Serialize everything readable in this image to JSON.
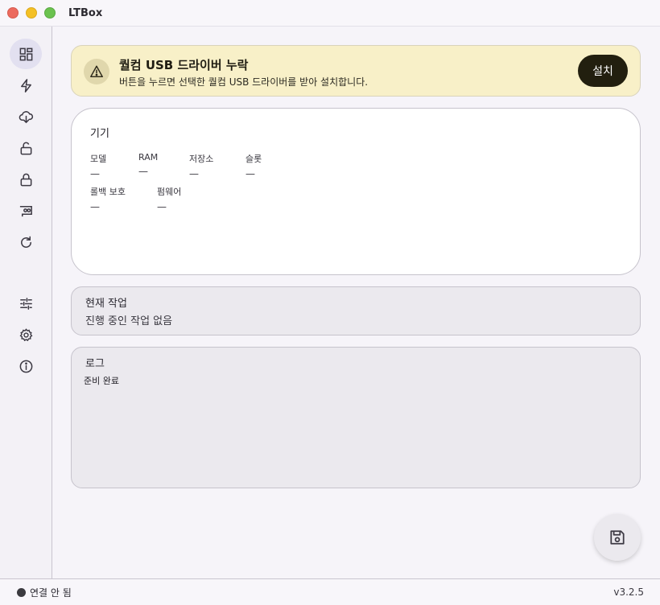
{
  "window": {
    "title": "LTBox"
  },
  "banner": {
    "title": "퀄컴 USB 드라이버 누락",
    "description": "버튼을 누르면 선택한 퀄컴 USB 드라이버를 받아 설치합니다.",
    "install_label": "설치",
    "icon": "warning-icon",
    "background": "#f8f0c8"
  },
  "device": {
    "title": "기기",
    "fields": [
      {
        "label": "모델",
        "value": "—"
      },
      {
        "label": "RAM",
        "value": "—"
      },
      {
        "label": "저장소",
        "value": "—"
      },
      {
        "label": "슬롯",
        "value": "—"
      },
      {
        "label": "롤백 보호",
        "value": "—"
      },
      {
        "label": "펌웨어",
        "value": "—"
      }
    ]
  },
  "task": {
    "title": "현재 작업",
    "status": "진행 중인 작업 없음"
  },
  "log": {
    "title": "로그",
    "text": "준비 완료"
  },
  "status": {
    "connection": "연결 안 됨",
    "version": "v3.2.5"
  },
  "sidebar": {
    "items": [
      {
        "icon": "dashboard-icon",
        "active": true
      },
      {
        "icon": "flash-icon"
      },
      {
        "icon": "cloud-download-icon"
      },
      {
        "icon": "unlock-icon"
      },
      {
        "icon": "lock-icon"
      },
      {
        "icon": "device-card-icon"
      },
      {
        "icon": "refresh-icon"
      },
      {
        "icon": "tune-icon"
      },
      {
        "icon": "settings-icon"
      },
      {
        "icon": "info-icon"
      }
    ]
  },
  "fab": {
    "icon": "save-icon"
  }
}
